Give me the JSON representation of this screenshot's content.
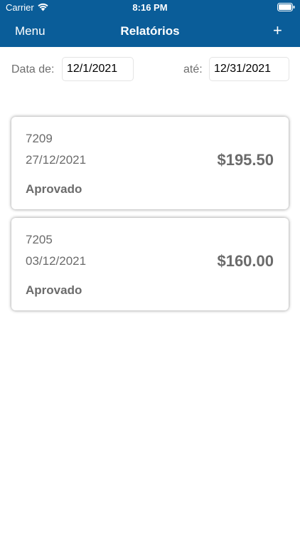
{
  "status_bar": {
    "carrier": "Carrier",
    "time": "8:16 PM"
  },
  "nav": {
    "menu_label": "Menu",
    "title": "Relatórios",
    "add_label": "+"
  },
  "filter": {
    "from_label": "Data de:",
    "from_value": "12/1/2021",
    "to_label": "até:",
    "to_value": "12/31/2021"
  },
  "reports": [
    {
      "id": "7209",
      "date": "27/12/2021",
      "amount": "$195.50",
      "status": "Aprovado"
    },
    {
      "id": "7205",
      "date": "03/12/2021",
      "amount": "$160.00",
      "status": "Aprovado"
    }
  ],
  "colors": {
    "header_background": "#0a5d99",
    "header_text": "#ffffff",
    "card_text": "#6b6b6b"
  },
  "icons": {
    "wifi": "wifi-icon",
    "battery": "battery-icon"
  }
}
